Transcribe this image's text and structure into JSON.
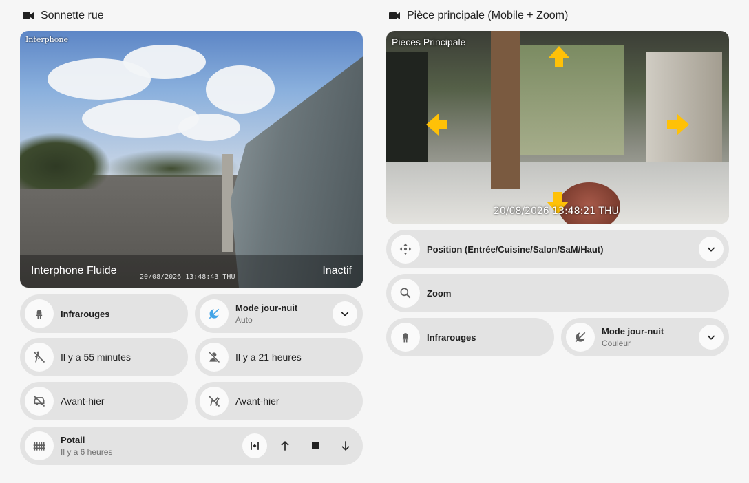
{
  "left": {
    "title": "Sonnette rue",
    "camera": {
      "overlay_name": "Interphone",
      "name": "Interphone Fluide",
      "state": "Inactif",
      "timestamp": "20/08/2026 13:48:43 THU"
    },
    "tiles": {
      "infrarouges": "Infrarouges",
      "mode_title": "Mode jour-nuit",
      "mode_value": "Auto",
      "motion": "Il y a 55 minutes",
      "person": "Il y a 21 heures",
      "vehicle": "Avant-hier",
      "animal": "Avant-hier",
      "gate_title": "Potail",
      "gate_value": "Il y a 6 heures"
    }
  },
  "right": {
    "title": "Pièce principale (Mobile + Zoom)",
    "camera": {
      "overlay_name": "Pieces Principale",
      "timestamp": "20/08/2026 13:48:21 THU"
    },
    "tiles": {
      "position": "Position (Entrée/Cuisine/Salon/SaM/Haut)",
      "zoom": "Zoom",
      "infrarouges": "Infrarouges",
      "mode_title": "Mode jour-nuit",
      "mode_value": "Couleur"
    }
  },
  "colors": {
    "tile_bg": "#e3e3e3",
    "page_bg": "#f6f6f6",
    "accent_active": "#44a5e8",
    "arrow": "#ffc107"
  },
  "icons": {
    "camera": "video-camera-icon",
    "ir": "led-icon",
    "day_night": "weather-night-icon",
    "motion": "motion-sensor-off-icon",
    "person": "account-off-icon",
    "vehicle": "car-off-icon",
    "animal": "dog-off-icon",
    "gate": "gate-icon",
    "position": "move-icon",
    "zoom": "magnify-icon"
  }
}
